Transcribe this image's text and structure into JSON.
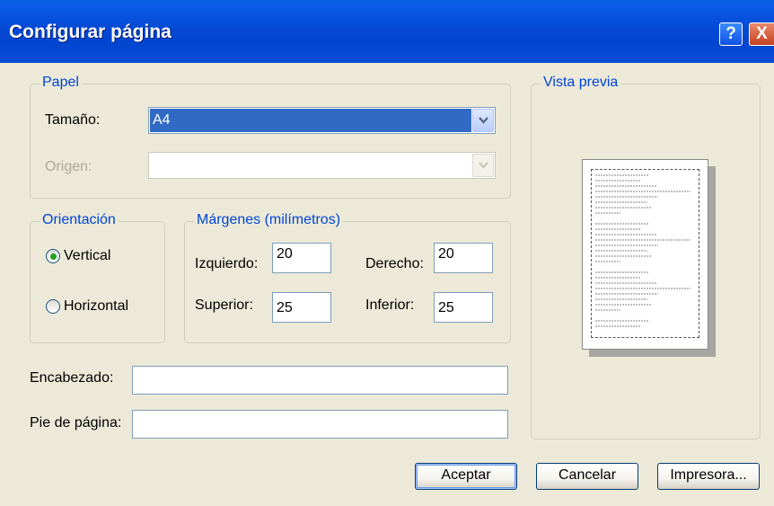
{
  "window": {
    "title": "Configurar página",
    "help_label": "?",
    "close_label": "X"
  },
  "paper": {
    "legend": "Papel",
    "size_label": "Tamaño:",
    "size_value": "A4",
    "source_label": "Origen:",
    "source_value": ""
  },
  "orientation": {
    "legend": "Orientación",
    "portrait_label": "Vertical",
    "landscape_label": "Horizontal",
    "selected": "Vertical"
  },
  "margins": {
    "legend": "Márgenes (milímetros)",
    "left_label": "Izquierdo:",
    "left_value": "20",
    "right_label": "Derecho:",
    "right_value": "20",
    "top_label": "Superior:",
    "top_value": "25",
    "bottom_label": "Inferior:",
    "bottom_value": "25"
  },
  "header": {
    "label": "Encabezado:",
    "value": ""
  },
  "footer": {
    "label": "Pie de página:",
    "value": ""
  },
  "preview": {
    "legend": "Vista previa"
  },
  "buttons": {
    "ok": "Aceptar",
    "cancel": "Cancelar",
    "printer": "Impresora..."
  },
  "colors": {
    "titlebar": "#0449d4",
    "legend_text": "#0046d5",
    "dialog_bg": "#ece9d8",
    "selection": "#316ac5"
  }
}
